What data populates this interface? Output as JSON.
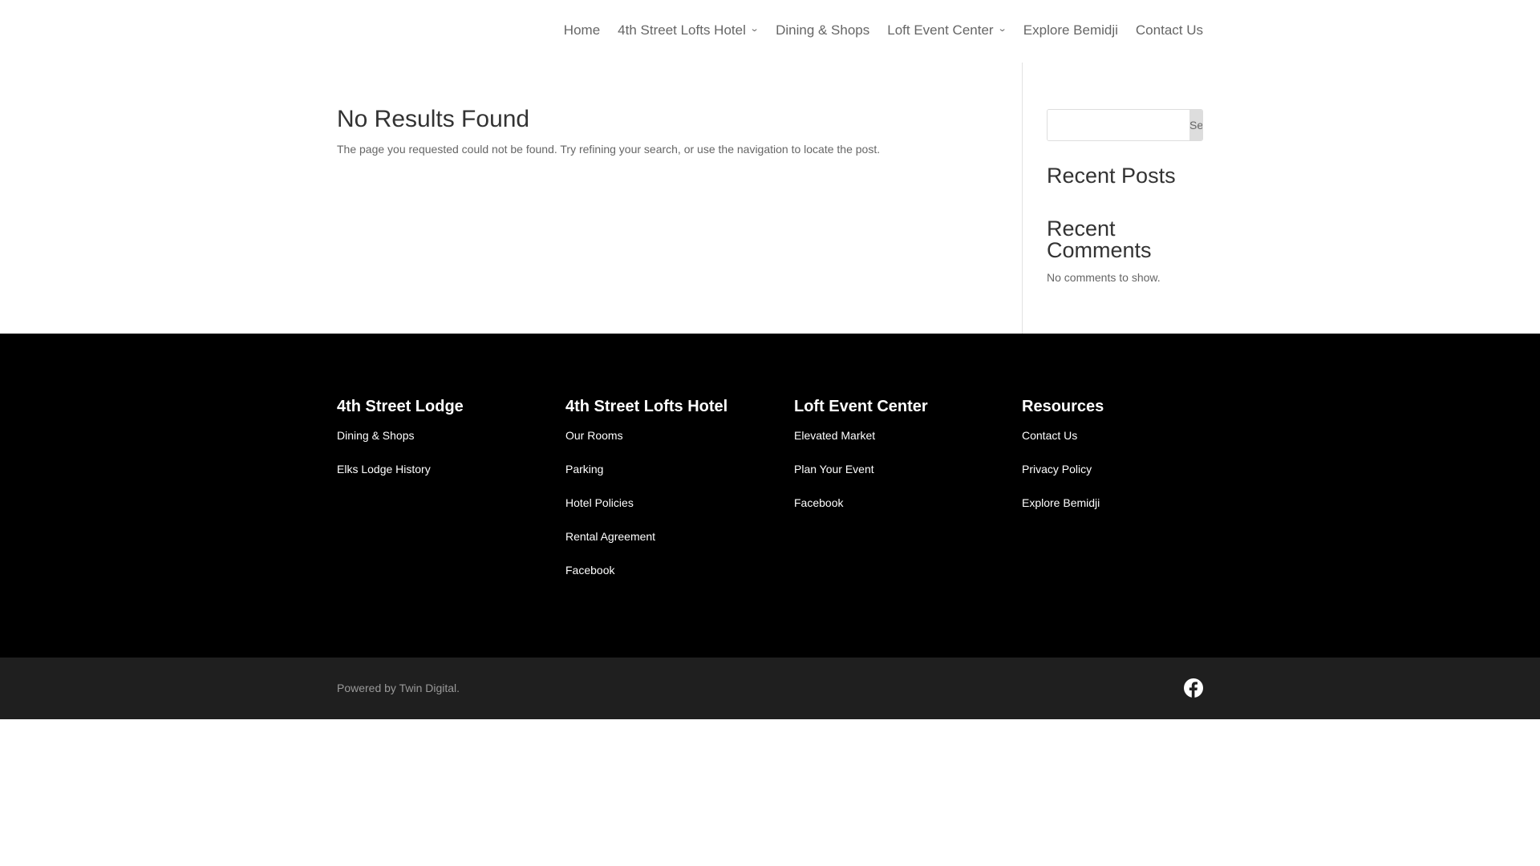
{
  "nav": {
    "items": [
      {
        "label": "Home"
      },
      {
        "label": "4th Street Lofts Hotel",
        "chevron": true
      },
      {
        "label": "Dining & Shops"
      },
      {
        "label": "Loft Event Center",
        "chevron": true
      },
      {
        "label": "Explore Bemidji"
      },
      {
        "label": "Contact Us"
      }
    ]
  },
  "main": {
    "title": "No Results Found",
    "message": "The page you requested could not be found. Try refining your search, or use the navigation to locate the post."
  },
  "sidebar": {
    "search_placeholder": "",
    "search_button": "Search",
    "recent_posts": "Recent Posts",
    "recent_comments": "Recent Comments",
    "no_comments": "No comments to show."
  },
  "footer": {
    "columns": [
      {
        "heading": "4th Street Lodge",
        "links": [
          "Dining & Shops",
          "Elks Lodge History"
        ]
      },
      {
        "heading": "4th Street Lofts Hotel",
        "links": [
          "Our Rooms",
          "Parking",
          "Hotel Policies",
          "Rental Agreement",
          "Facebook"
        ]
      },
      {
        "heading": "Loft Event Center",
        "links": [
          "Elevated Market",
          "Plan Your Event",
          "Facebook"
        ]
      },
      {
        "heading": "Resources",
        "links": [
          "Contact Us",
          "Privacy Policy",
          "Explore Bemidji"
        ]
      }
    ],
    "powered": "Powered by Twin Digital.",
    "social_icon": "facebook-icon"
  }
}
